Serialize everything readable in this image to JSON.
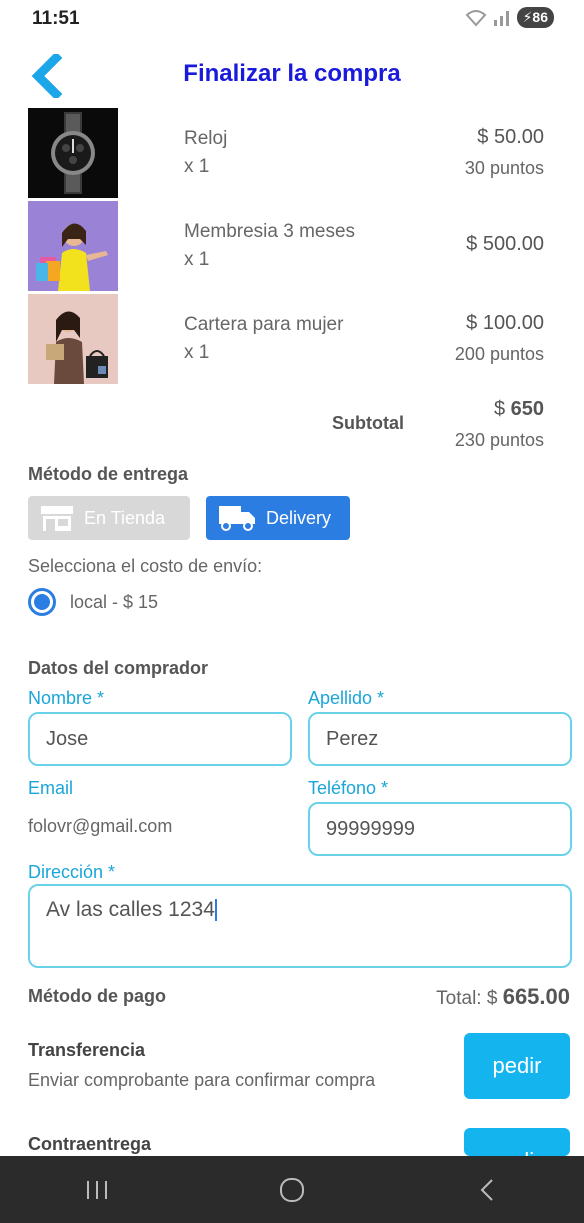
{
  "status_bar": {
    "time": "11:51",
    "battery": "86",
    "battery_prefix": "⚡"
  },
  "header": {
    "title": "Finalizar la compra"
  },
  "products": [
    {
      "name": "Reloj",
      "qty": "x 1",
      "price": "$ 50.00",
      "points": "30 puntos",
      "image": "watch"
    },
    {
      "name": "Membresia 3 meses",
      "qty": "x 1",
      "price": "$ 500.00",
      "points": "",
      "image": "shopping-woman"
    },
    {
      "name": "Cartera para mujer",
      "qty": "x 1",
      "price": "$ 100.00",
      "points": "200 puntos",
      "image": "purse-woman"
    }
  ],
  "subtotal": {
    "label": "Subtotal",
    "currency": "$ ",
    "amount": "650",
    "points": "230 puntos"
  },
  "delivery": {
    "label": "Método de entrega",
    "tienda": "En Tienda",
    "delivery": "Delivery",
    "shipping_label": "Selecciona el costo de envío:",
    "option": "local - $ 15"
  },
  "buyer": {
    "label": "Datos del comprador",
    "nombre_label": "Nombre *",
    "nombre_value": "Jose",
    "apellido_label": "Apellido *",
    "apellido_value": "Perez",
    "email_label": "Email",
    "email_value": "folovr@gmail.com",
    "telefono_label": "Teléfono *",
    "telefono_value": "99999999",
    "direccion_label": "Dirección *",
    "direccion_value": "Av las calles 1234"
  },
  "payment": {
    "label": "Método de pago",
    "total_prefix": "Total: $ ",
    "total_amount": "665.00",
    "methods": [
      {
        "title": "Transferencia",
        "desc": "Enviar comprobante para confirmar compra",
        "button": "pedir"
      },
      {
        "title": "Contraentrega",
        "button": "pedir"
      }
    ]
  },
  "colors": {
    "accent": "#2b7de1",
    "title": "#1a1adb",
    "field_border": "#6ad2e8",
    "label": "#1aa6d8",
    "order_button": "#14b5ef"
  },
  "icons": [
    "back-chevron-icon",
    "wifi-icon",
    "signal-icon",
    "store-icon",
    "truck-icon",
    "recents-icon",
    "home-icon",
    "back-icon"
  ]
}
